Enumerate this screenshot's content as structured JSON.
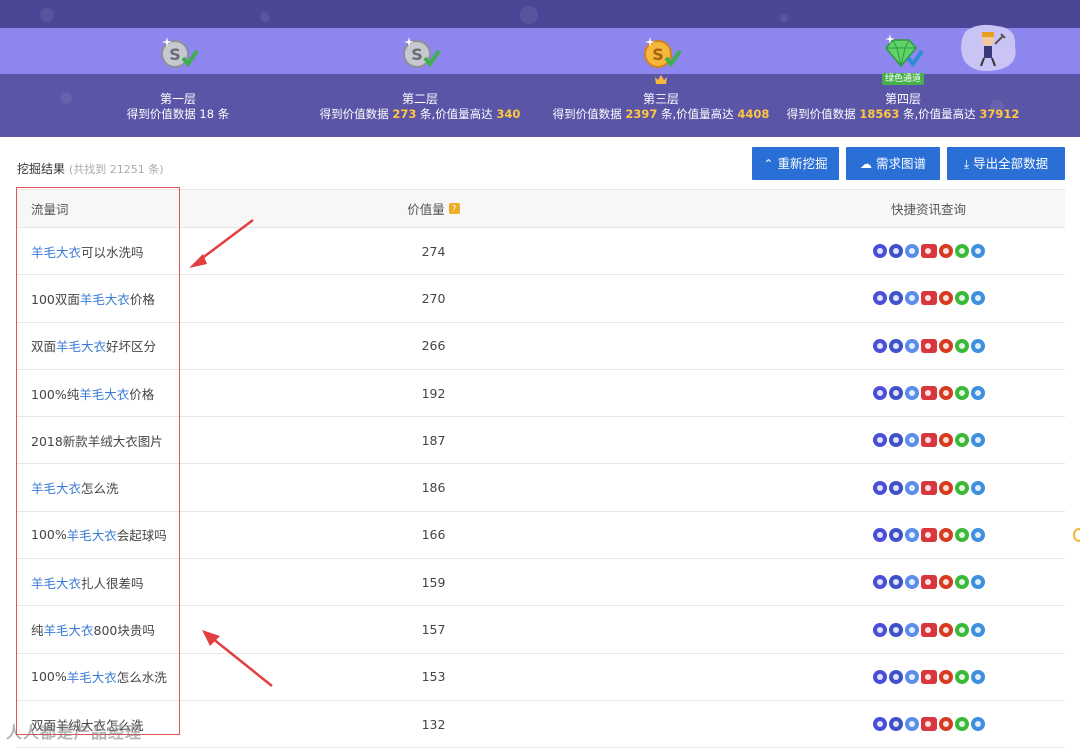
{
  "banner": {
    "levels": [
      {
        "name": "第一层",
        "stat_prefix": "得到价值数据 ",
        "count": "18",
        "stat_mid": " 条",
        "value": "",
        "value_prefix": ""
      },
      {
        "name": "第二层",
        "stat_prefix": "得到价值数据 ",
        "count": "273",
        "stat_mid": " 条,价值量高达 ",
        "value": "340"
      },
      {
        "name": "第三层",
        "stat_prefix": "得到价值数据 ",
        "count": "2397",
        "stat_mid": " 条,价值量高达 ",
        "value": "4408"
      },
      {
        "name": "第四层",
        "stat_prefix": "得到价值数据 ",
        "count": "18563",
        "stat_mid": " 条,价值量高达 ",
        "value": "37912",
        "tag": "绿色通道"
      }
    ],
    "medal_icons": [
      "silver-coin-icon",
      "silver-coin-icon",
      "gold-coin-icon",
      "diamond-icon"
    ]
  },
  "toolbar": {
    "title": "挖掘结果",
    "count_text": "(共找到 21251 条)",
    "reset_label": "重新挖掘",
    "map_label": "需求图谱",
    "export_label": "导出全部数据"
  },
  "table": {
    "headers": {
      "word": "流量词",
      "value": "价值量",
      "links": "快捷资讯查询"
    },
    "rows": [
      {
        "pre": "",
        "kw": "羊毛大衣",
        "post": "可以水洗吗",
        "value": "274"
      },
      {
        "pre": "100双面",
        "kw": "羊毛大衣",
        "post": "价格",
        "value": "270"
      },
      {
        "pre": "双面",
        "kw": "羊毛大衣",
        "post": "好坏区分",
        "value": "266"
      },
      {
        "pre": "100%纯",
        "kw": "羊毛大衣",
        "post": "价格",
        "value": "192"
      },
      {
        "pre": "2018新款羊绒大衣图片",
        "kw": "",
        "post": "",
        "value": "187"
      },
      {
        "pre": "",
        "kw": "羊毛大衣",
        "post": "怎么洗",
        "value": "186"
      },
      {
        "pre": "100%",
        "kw": "羊毛大衣",
        "post": "会起球吗",
        "value": "166"
      },
      {
        "pre": "",
        "kw": "羊毛大衣",
        "post": "扎人很差吗",
        "value": "159"
      },
      {
        "pre": "纯",
        "kw": "羊毛大衣",
        "post": "800块贵吗",
        "value": "157"
      },
      {
        "pre": "100%",
        "kw": "羊毛大衣",
        "post": "怎么水洗",
        "value": "153"
      },
      {
        "pre": "双面羊绒大衣怎么洗",
        "kw": "",
        "post": "",
        "value": "132"
      }
    ]
  },
  "watermark": "人人都是产品经理"
}
